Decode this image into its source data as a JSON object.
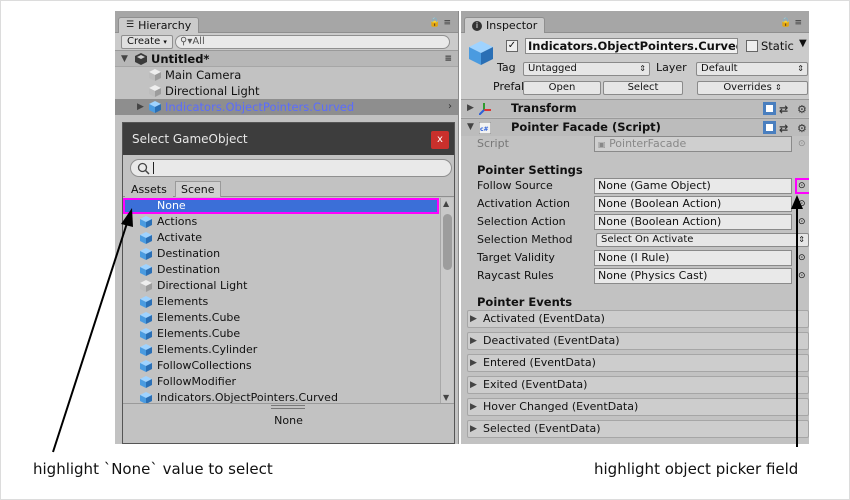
{
  "hierarchy": {
    "tab_label": "Hierarchy",
    "create_label": "Create",
    "search_placeholder": "All",
    "scene_name": "Untitled*",
    "items": [
      {
        "label": "Main Camera"
      },
      {
        "label": "Directional Light"
      },
      {
        "label": "Indicators.ObjectPointers.Curved"
      }
    ]
  },
  "picker": {
    "title": "Select GameObject",
    "close_label": "x",
    "tabs": [
      "Assets",
      "Scene"
    ],
    "items": [
      "None",
      "Actions",
      "Activate",
      "Destination",
      "Destination",
      "Directional Light",
      "Elements",
      "Elements.Cube",
      "Elements.Cube",
      "Elements.Cylinder",
      "FollowCollections",
      "FollowModifier",
      "Indicators.ObjectPointers.Curved"
    ],
    "footer_label": "None"
  },
  "inspector": {
    "tab_label": "Inspector",
    "object_name": "Indicators.ObjectPointers.Curved",
    "static_label": "Static",
    "tag_label": "Tag",
    "tag_value": "Untagged",
    "layer_label": "Layer",
    "layer_value": "Default",
    "prefab_label": "Prefab",
    "open_label": "Open",
    "select_label": "Select",
    "overrides_label": "Overrides",
    "transform_label": "Transform",
    "component_label": "Pointer Facade (Script)",
    "script_label": "Script",
    "script_value": "PointerFacade",
    "settings_header": "Pointer Settings",
    "fields": [
      {
        "label": "Follow Source",
        "value": "None (Game Object)"
      },
      {
        "label": "Activation Action",
        "value": "None (Boolean Action)"
      },
      {
        "label": "Selection Action",
        "value": "None (Boolean Action)"
      },
      {
        "label": "Selection Method",
        "value": "Select On Activate"
      },
      {
        "label": "Target Validity",
        "value": "None (I Rule)"
      },
      {
        "label": "Raycast Rules",
        "value": "None (Physics Cast)"
      }
    ],
    "events_header": "Pointer Events",
    "events": [
      "Activated (EventData)",
      "Deactivated (EventData)",
      "Entered (EventData)",
      "Exited (EventData)",
      "Hover Changed (EventData)",
      "Selected (EventData)"
    ]
  },
  "annotations": {
    "left": "highlight `None` value to select",
    "right": "highlight object picker field"
  },
  "colors": {
    "highlight": "#ff00ff",
    "selection_blue": "#3b6fd8",
    "panel": "#c2c2c2"
  }
}
